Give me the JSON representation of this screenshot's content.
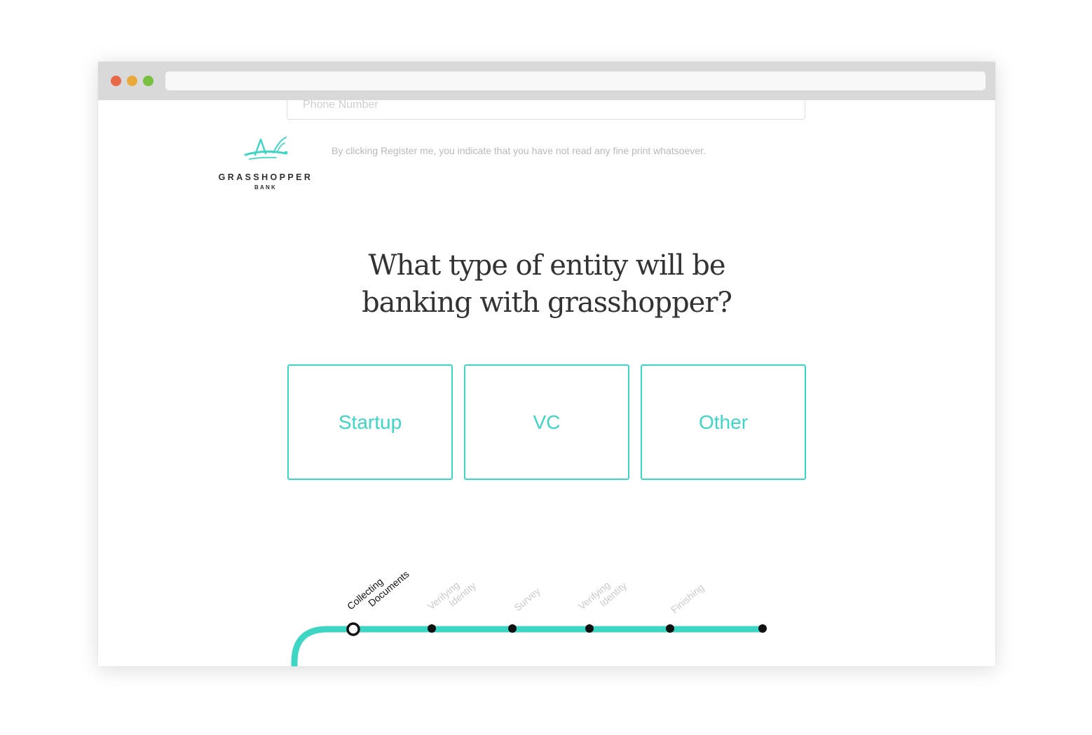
{
  "phone_field": {
    "placeholder": "Phone Number"
  },
  "brand": {
    "name": "GRASSHOPPER",
    "sub": "BANK",
    "accent": "#3dd6c4"
  },
  "fine_print": "By clicking Register me, you indicate that you have not read any fine print whatsoever.",
  "question": {
    "line1": "What type of entity will be",
    "line2": "banking with grasshopper?"
  },
  "options": [
    {
      "label": "Startup"
    },
    {
      "label": "VC"
    },
    {
      "label": "Other"
    }
  ],
  "progress": {
    "current_step": 0,
    "steps": [
      {
        "line1": "Collecting",
        "line2": "Documents"
      },
      {
        "line1": "Verifying",
        "line2": "Identity"
      },
      {
        "line1": "Survey",
        "line2": ""
      },
      {
        "line1": "Verifying",
        "line2": "Identity"
      },
      {
        "line1": "Finishing",
        "line2": ""
      }
    ]
  }
}
